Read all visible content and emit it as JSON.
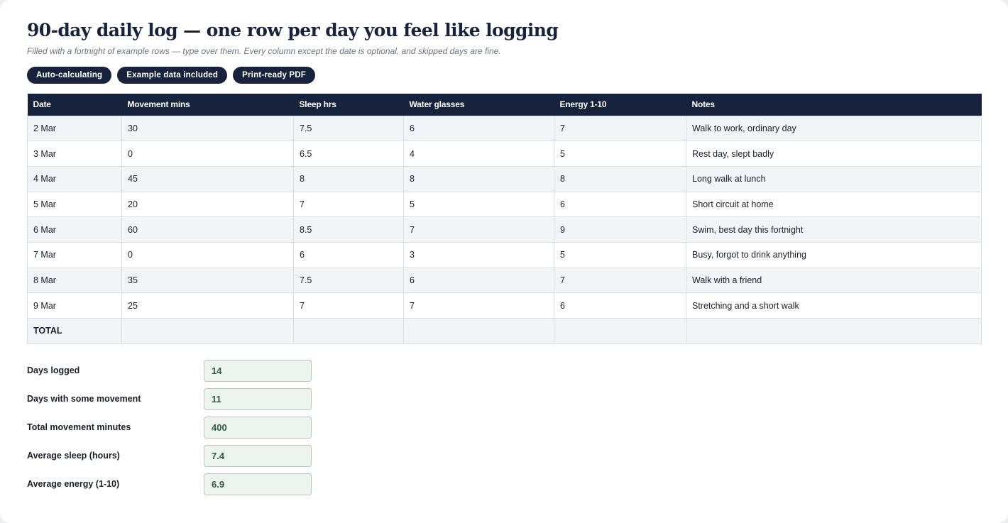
{
  "header": {
    "title": "90-day daily log — one row per day you feel like logging",
    "subtitle": "Filled with a fortnight of example rows — type over them. Every column except the date is optional, and skipped days are fine."
  },
  "badges": [
    "Auto-calculating",
    "Example data included",
    "Print-ready PDF"
  ],
  "table": {
    "columns": [
      "Date",
      "Movement mins",
      "Sleep hrs",
      "Water glasses",
      "Energy 1-10",
      "Notes"
    ],
    "rows": [
      [
        "2 Mar",
        "30",
        "7.5",
        "6",
        "7",
        "Walk to work, ordinary day"
      ],
      [
        "3 Mar",
        "0",
        "6.5",
        "4",
        "5",
        "Rest day, slept badly"
      ],
      [
        "4 Mar",
        "45",
        "8",
        "8",
        "8",
        "Long walk at lunch"
      ],
      [
        "5 Mar",
        "20",
        "7",
        "5",
        "6",
        "Short circuit at home"
      ],
      [
        "6 Mar",
        "60",
        "8.5",
        "7",
        "9",
        "Swim, best day this fortnight"
      ],
      [
        "7 Mar",
        "0",
        "6",
        "3",
        "5",
        "Busy, forgot to drink anything"
      ],
      [
        "8 Mar",
        "35",
        "7.5",
        "6",
        "7",
        "Walk with a friend"
      ],
      [
        "9 Mar",
        "25",
        "7",
        "7",
        "6",
        "Stretching and a short walk"
      ]
    ],
    "total_label": "TOTAL"
  },
  "summary": [
    {
      "label": "Days logged",
      "value": "14"
    },
    {
      "label": "Days with some movement",
      "value": "11"
    },
    {
      "label": "Total movement minutes",
      "value": "400"
    },
    {
      "label": "Average sleep (hours)",
      "value": "7.4"
    },
    {
      "label": "Average energy (1-10)",
      "value": "6.9"
    }
  ],
  "colors": {
    "navy": "#17233d",
    "summary_value": "#2e5b44",
    "summary_box_bg": "#edf3ee"
  }
}
